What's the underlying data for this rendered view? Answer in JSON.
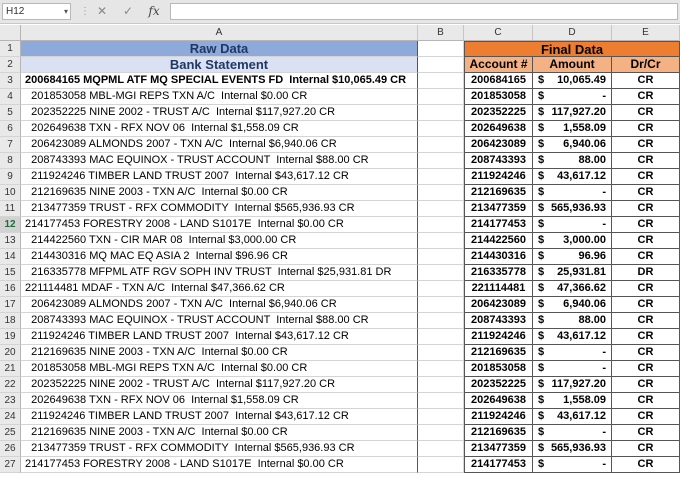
{
  "formula_bar": {
    "name_box": "H12",
    "cancel_icon": "✕",
    "enter_icon": "✓",
    "fx_label": "fx",
    "formula": ""
  },
  "columns": [
    "A",
    "B",
    "C",
    "D",
    "E"
  ],
  "header_rows": {
    "row1": {
      "num": "1",
      "raw_title": "Raw Data",
      "final_title": "Final Data"
    },
    "row2": {
      "num": "2",
      "bank_title": "Bank Statement",
      "col_account": "Account #",
      "col_amount": "Amount",
      "col_drcr": "Dr/Cr"
    }
  },
  "rows": [
    {
      "num": "3",
      "text": "200684165 MQPML ATF MQ SPECIAL EVENTS FD  Internal $10,065.49 CR",
      "account": "200684165",
      "sign": "$",
      "amount": "10,065.49",
      "drcr": "CR"
    },
    {
      "num": "4",
      "text": "  201853058 MBL-MGI REPS TXN A/C  Internal $0.00 CR",
      "account": "201853058",
      "sign": "$",
      "amount": "-",
      "drcr": "CR"
    },
    {
      "num": "5",
      "text": "  202352225 NINE 2002 - TRUST A/C  Internal $117,927.20 CR",
      "account": "202352225",
      "sign": "$",
      "amount": "117,927.20",
      "drcr": "CR"
    },
    {
      "num": "6",
      "text": "  202649638 TXN - RFX NOV 06  Internal $1,558.09 CR",
      "account": "202649638",
      "sign": "$",
      "amount": "1,558.09",
      "drcr": "CR"
    },
    {
      "num": "7",
      "text": "  206423089 ALMONDS 2007 - TXN A/C  Internal $6,940.06 CR",
      "account": "206423089",
      "sign": "$",
      "amount": "6,940.06",
      "drcr": "CR"
    },
    {
      "num": "8",
      "text": "  208743393 MAC EQUINOX - TRUST ACCOUNT  Internal $88.00 CR",
      "account": "208743393",
      "sign": "$",
      "amount": "88.00",
      "drcr": "CR"
    },
    {
      "num": "9",
      "text": "  211924246 TIMBER LAND TRUST 2007  Internal $43,617.12 CR",
      "account": "211924246",
      "sign": "$",
      "amount": "43,617.12",
      "drcr": "CR"
    },
    {
      "num": "10",
      "text": "  212169635 NINE 2003 - TXN A/C  Internal $0.00 CR",
      "account": "212169635",
      "sign": "$",
      "amount": "-",
      "drcr": "CR"
    },
    {
      "num": "11",
      "text": "  213477359 TRUST - RFX COMMODITY  Internal $565,936.93 CR",
      "account": "213477359",
      "sign": "$",
      "amount": "565,936.93",
      "drcr": "CR"
    },
    {
      "num": "12",
      "text": "214177453 FORESTRY 2008 - LAND S1017E  Internal $0.00 CR",
      "account": "214177453",
      "sign": "$",
      "amount": "-",
      "drcr": "CR"
    },
    {
      "num": "13",
      "text": "  214422560 TXN - CIR MAR 08  Internal $3,000.00 CR",
      "account": "214422560",
      "sign": "$",
      "amount": "3,000.00",
      "drcr": "CR"
    },
    {
      "num": "14",
      "text": "  214430316 MQ MAC EQ ASIA 2  Internal $96.96 CR",
      "account": "214430316",
      "sign": "$",
      "amount": "96.96",
      "drcr": "CR"
    },
    {
      "num": "15",
      "text": "  216335778 MFPML ATF RGV SOPH INV TRUST  Internal $25,931.81 DR",
      "account": "216335778",
      "sign": "$",
      "amount": "25,931.81",
      "drcr": "DR"
    },
    {
      "num": "16",
      "text": "221114481 MDAF - TXN A/C  Internal $47,366.62 CR",
      "account": "221114481",
      "sign": "$",
      "amount": "47,366.62",
      "drcr": "CR"
    },
    {
      "num": "17",
      "text": "  206423089 ALMONDS 2007 - TXN A/C  Internal $6,940.06 CR",
      "account": "206423089",
      "sign": "$",
      "amount": "6,940.06",
      "drcr": "CR"
    },
    {
      "num": "18",
      "text": "  208743393 MAC EQUINOX - TRUST ACCOUNT  Internal $88.00 CR",
      "account": "208743393",
      "sign": "$",
      "amount": "88.00",
      "drcr": "CR"
    },
    {
      "num": "19",
      "text": "  211924246 TIMBER LAND TRUST 2007  Internal $43,617.12 CR",
      "account": "211924246",
      "sign": "$",
      "amount": "43,617.12",
      "drcr": "CR"
    },
    {
      "num": "20",
      "text": "  212169635 NINE 2003 - TXN A/C  Internal $0.00 CR",
      "account": "212169635",
      "sign": "$",
      "amount": "-",
      "drcr": "CR"
    },
    {
      "num": "21",
      "text": "  201853058 MBL-MGI REPS TXN A/C  Internal $0.00 CR",
      "account": "201853058",
      "sign": "$",
      "amount": "-",
      "drcr": "CR"
    },
    {
      "num": "22",
      "text": "  202352225 NINE 2002 - TRUST A/C  Internal $117,927.20 CR",
      "account": "202352225",
      "sign": "$",
      "amount": "117,927.20",
      "drcr": "CR"
    },
    {
      "num": "23",
      "text": "  202649638 TXN - RFX NOV 06  Internal $1,558.09 CR",
      "account": "202649638",
      "sign": "$",
      "amount": "1,558.09",
      "drcr": "CR"
    },
    {
      "num": "24",
      "text": "  211924246 TIMBER LAND TRUST 2007  Internal $43,617.12 CR",
      "account": "211924246",
      "sign": "$",
      "amount": "43,617.12",
      "drcr": "CR"
    },
    {
      "num": "25",
      "text": "  212169635 NINE 2003 - TXN A/C  Internal $0.00 CR",
      "account": "212169635",
      "sign": "$",
      "amount": "-",
      "drcr": "CR"
    },
    {
      "num": "26",
      "text": "  213477359 TRUST - RFX COMMODITY  Internal $565,936.93 CR",
      "account": "213477359",
      "sign": "$",
      "amount": "565,936.93",
      "drcr": "CR"
    },
    {
      "num": "27",
      "text": "214177453 FORESTRY 2008 - LAND S1017E  Internal $0.00 CR",
      "account": "214177453",
      "sign": "$",
      "amount": "-",
      "drcr": "CR"
    }
  ],
  "colors": {
    "raw_header": "#8eaadb",
    "bank_header": "#d9e1f2",
    "final_header": "#ed7d31",
    "final_subheader": "#f4b183",
    "selected_row_header": "#d2d2d2"
  },
  "selected_row": "12"
}
